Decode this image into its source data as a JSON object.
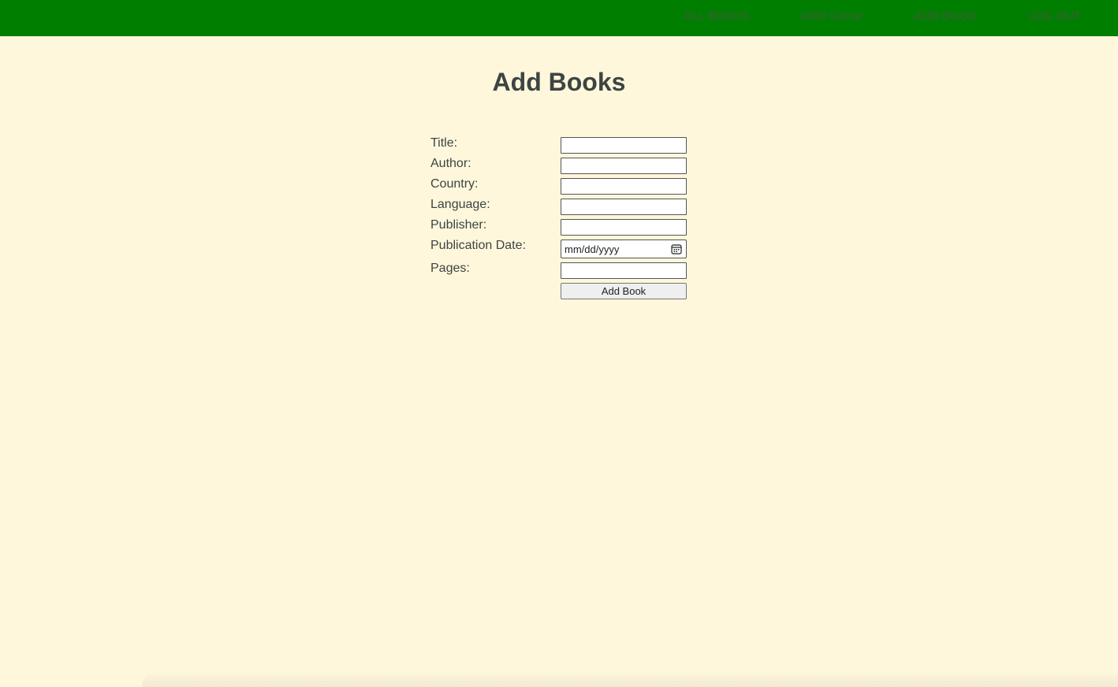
{
  "nav": {
    "items": [
      {
        "label": "ALL BOOKS"
      },
      {
        "label": "ADD Genre"
      },
      {
        "label": "ADD BOOK"
      },
      {
        "label": "LOG OUT"
      }
    ]
  },
  "page": {
    "title": "Add Books"
  },
  "form": {
    "title_label": "Title:",
    "author_label": "Author:",
    "country_label": "Country:",
    "language_label": "Language:",
    "publisher_label": "Publisher:",
    "publication_date_label": "Publication Date:",
    "publication_date_placeholder": "mm/dd/yyyy",
    "pages_label": "Pages:",
    "submit_label": "Add Book"
  },
  "colors": {
    "navbar": "#007e00",
    "background": "#fef7dc",
    "text": "#3d4443"
  },
  "icons": {
    "date_picker": "calendar-icon"
  }
}
